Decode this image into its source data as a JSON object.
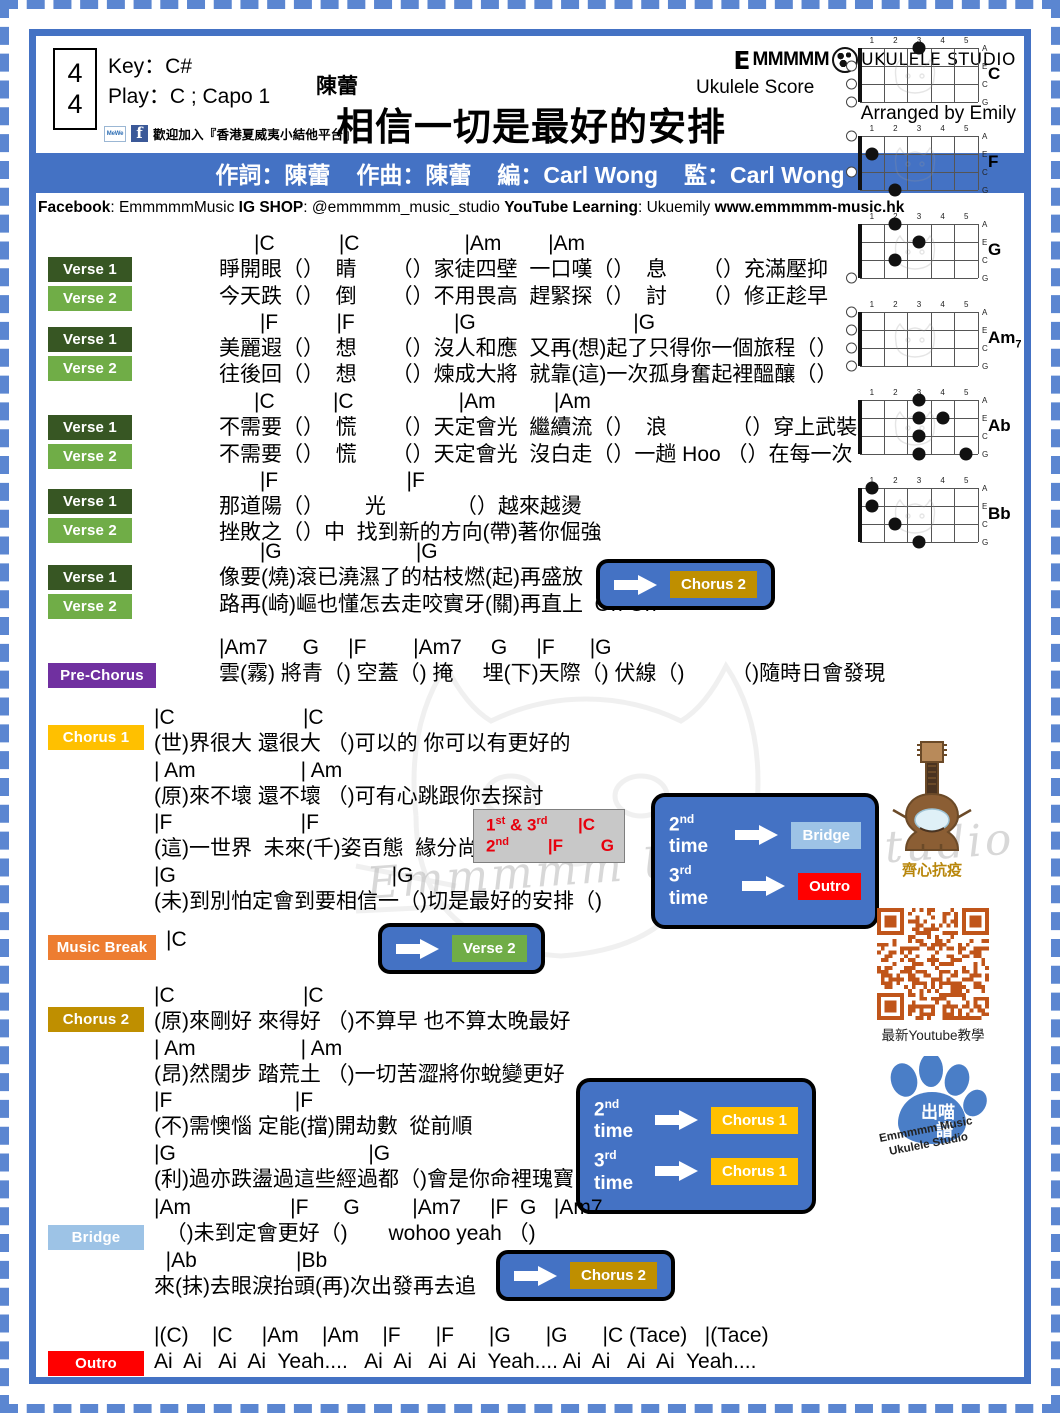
{
  "meta": {
    "time_signature_top": "4",
    "time_signature_bottom": "4",
    "key_line": "Key：C#",
    "play_line": "Play：C ; Capo 1",
    "mewe_label": "MeWe",
    "facebook_glyph": "f",
    "follow_text": "歡迎加入『香港夏威夷小結他平台』",
    "artist": "陳蕾",
    "title": "相信一切是最好的安排",
    "brand_e": "E",
    "brand_m": "MMMMM",
    "brand_rest": "UKULELE STUDIO",
    "score_label": "Ukulele Score",
    "arranged_by": "Arranged by Emily"
  },
  "credits": {
    "lyricist": "作詞：陳蕾",
    "composer": "作曲：陳蕾",
    "arranger": "編：Carl Wong",
    "producer": "監：Carl Wong"
  },
  "social": {
    "fb_label": "Facebook",
    "fb_value": ": EmmmmmMusic ",
    "ig_label": "IG SHOP",
    "ig_value": ": @emmmmm_music_studio ",
    "yt_label": "YouTube Learning",
    "yt_value": ": Ukuemily  ",
    "website": "www.emmmmm-music.hk"
  },
  "tags": {
    "verse1": "Verse 1",
    "verse2": "Verse 2",
    "pre_chorus": "Pre-Chorus",
    "chorus1": "Chorus  1",
    "music_break": "Music Break",
    "chorus2": "Chorus 2",
    "bridge": "Bridge",
    "outro": "Outro"
  },
  "colors": {
    "verse1": "#375623",
    "verse2": "#70ad47",
    "pre_chorus": "#7030a0",
    "chorus1": "#ffc000",
    "music_break": "#ed7d31",
    "chorus2": "#bf8f00",
    "bridge": "#9dc3e6",
    "outro": "#ff0000",
    "blue_bar": "#4472c4",
    "red_text": "#e8000d"
  },
  "sections": {
    "v_a": {
      "chord_line1": "            |C           |C                  |Am        |Am",
      "lyric_v1_1": "      睜開眼（）  睛      （）家徒四壁  一口嘆（）  息      （）充滿壓抑",
      "lyric_v2_1": "      今天跌（）  倒      （）不用畏高  趕緊探（）  討      （）修正趁早",
      "chord_line2": "             |F          |F                 |G                           |G",
      "lyric_v1_2": "      美麗遐（）  想      （）沒人和應  又再(想)起了只得你一個旅程（）",
      "lyric_v2_2": "      往後回（）  想      （）煉成大將  就靠(這)一次孤身奮起裡醞釀（）"
    },
    "v_b": {
      "chord_line1": "            |C          |C                  |Am          |Am",
      "lyric_v1_1": "      不需要（）  慌      （）天定會光  繼續流（）  浪           （）穿上武裝",
      "lyric_v2_1": "      不需要（）  慌      （）天定會光  沒白走（）一趟 Hoo （）在每一次",
      "chord_line2": "             |F                      |F",
      "lyric_v1_2": "      那道陽（）       光            （）越來越燙",
      "lyric_v2_2": "      挫敗之（）中  找到新的方向(帶)著你倔強"
    },
    "v_c": {
      "chord_line1": "             |G                       |G",
      "lyric_v1_1": "      像要(燒)滾已澆濕了的枯枝燃(起)再盛放",
      "lyric_v2_1": "      路再(崎)嶇也懂怎去走咬實牙(關)再直上  Oh Oh"
    },
    "pre_chorus": {
      "chord_line": "      |Am7      G     |F        |Am7     G     |F      |G",
      "lyric": "      雲(霧) 將青（) 空蓋（) 掩     埋(下)天際（) 伏線（)        （)隨時日會發現"
    },
    "chorus1": {
      "lines": [
        "|C                      |C",
        "(世)界很大 還很大 （)可以的 你可以有更好的",
        "| Am                  | Am",
        "(原)來不壞 還不壞 （)可有心跳跟你去探討",
        "|F                      |F",
        "(這)一世界  未來(千)姿百態  緣分尚淺",
        "|G                                     |G",
        "(未)到別怕定會到要相信一（)切是最好的安排（)"
      ]
    },
    "music_break": {
      "chord_line": "|C"
    },
    "chorus2": {
      "lines": [
        "|C                      |C",
        "(原)來剛好 來得好 （)不算早 也不算太晚最好",
        "| Am                  | Am",
        "(昂)然闊步 踏荒土 （)一切苦澀將你蛻變更好",
        "|F                     |F",
        "(不)需懊惱 定能(擋)開劫數  從前順",
        "|G                                 |G",
        "(利)過亦跌盪過這些經過都（)會是你命裡瑰寶"
      ]
    },
    "bridge": {
      "chord_line1": "|Am                 |F      G         |Am7     |F  G   |Am7",
      "lyric_line1": "  （)未到定會更好（)       wohoo yeah （)",
      "chord_line2": "  |Ab                 |Bb",
      "lyric_line2": "來(抹)去眼淚抬頭(再)次出發再去追"
    },
    "outro": {
      "chord_line": "|(C)    |C     |Am    |Am    |F      |F      |G      |G      |C (Tace)   |(Tace)",
      "lyric_line": "Ai  Ai   Ai  Ai  Yeah....   Ai  Ai   Ai  Ai  Yeah.... Ai  Ai   Ai  Ai  Yeah...."
    }
  },
  "repeat_boxes": {
    "verse_to_chorus2": {
      "target": "Chorus 2"
    },
    "break_to_verse2": {
      "target": "Verse 2"
    },
    "bridge_to_chorus2": {
      "target": "Chorus 2"
    },
    "chorus1_endings": {
      "row1_label": "1st & 3rd",
      "row1_chords": "|C",
      "row2_label": "2nd",
      "row2_chords": "|F        G"
    },
    "chorus1_times": {
      "row1_label": "2nd time",
      "row1_target": "Bridge",
      "row2_label": "3rd time",
      "row2_target": "Outro"
    },
    "chorus2_times": {
      "row1_label": "2nd time",
      "row1_target": "Chorus 1",
      "row2_label": "3rd time",
      "row2_target": "Chorus 1"
    }
  },
  "chord_diagrams": [
    {
      "name": "C",
      "sub": "",
      "strings": [
        "A",
        "E",
        "C",
        "G"
      ],
      "frets": [
        "1",
        "2",
        "3",
        "4",
        "5"
      ],
      "dots": [
        {
          "string": 0,
          "fret": 3
        }
      ],
      "open": [
        1,
        2,
        3
      ]
    },
    {
      "name": "F",
      "sub": "",
      "strings": [
        "A",
        "E",
        "C",
        "G"
      ],
      "frets": [
        "1",
        "2",
        "3",
        "4",
        "5"
      ],
      "dots": [
        {
          "string": 1,
          "fret": 1
        },
        {
          "string": 3,
          "fret": 2
        }
      ],
      "open": [
        0,
        2
      ]
    },
    {
      "name": "G",
      "sub": "",
      "strings": [
        "A",
        "E",
        "C",
        "G"
      ],
      "frets": [
        "1",
        "2",
        "3",
        "4",
        "5"
      ],
      "dots": [
        {
          "string": 0,
          "fret": 2
        },
        {
          "string": 1,
          "fret": 3
        },
        {
          "string": 2,
          "fret": 2
        }
      ],
      "open": [
        3
      ]
    },
    {
      "name": "Am",
      "sub": "7",
      "strings": [
        "A",
        "E",
        "C",
        "G"
      ],
      "frets": [
        "1",
        "2",
        "3",
        "4",
        "5"
      ],
      "dots": [],
      "open": [
        0,
        1,
        2,
        3
      ]
    },
    {
      "name": "Ab",
      "sub": "",
      "strings": [
        "A",
        "E",
        "C",
        "G"
      ],
      "frets": [
        "1",
        "2",
        "3",
        "4",
        "5"
      ],
      "dots": [
        {
          "string": 0,
          "fret": 3
        },
        {
          "string": 1,
          "fret": 3
        },
        {
          "string": 1,
          "fret": 4
        },
        {
          "string": 2,
          "fret": 3
        },
        {
          "string": 3,
          "fret": 3
        },
        {
          "string": 3,
          "fret": 5
        }
      ],
      "open": []
    },
    {
      "name": "Bb",
      "sub": "",
      "strings": [
        "A",
        "E",
        "C",
        "G"
      ],
      "frets": [
        "1",
        "2",
        "3",
        "4",
        "5"
      ],
      "dots": [
        {
          "string": 0,
          "fret": 1
        },
        {
          "string": 1,
          "fret": 1
        },
        {
          "string": 2,
          "fret": 2
        },
        {
          "string": 3,
          "fret": 3
        }
      ],
      "open": []
    }
  ],
  "graphics": {
    "uke_mask_caption": "齊心抗疫",
    "qr_caption": "最新Youtube教學",
    "paw_text_cn": "出喵譜",
    "paw_text_1": "Emmmmm Music",
    "paw_text_2": "Ukulele Studio",
    "watermark_text": "Emmmmm Ukulele Studio"
  }
}
